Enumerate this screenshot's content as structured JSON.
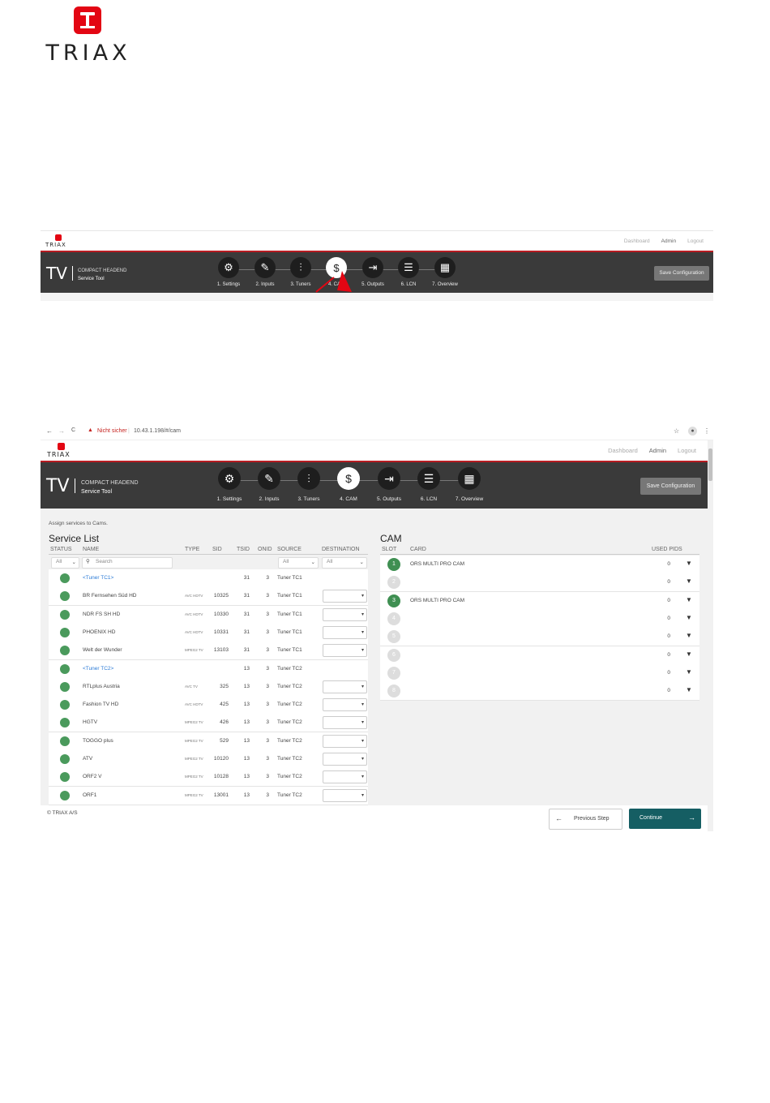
{
  "logo": {
    "word": "TRIAX"
  },
  "screen1": {
    "logo_word": "TRIAX",
    "top_links": [
      "Dashboard",
      "Admin",
      "Logout"
    ],
    "brand": {
      "tv": "TV",
      "line1": "COMPACT HEADEND",
      "line2": "Service Tool"
    },
    "steps": [
      {
        "label": "1. Settings",
        "icon": "gear-icon",
        "glyph": "⚙"
      },
      {
        "label": "2. Inputs",
        "icon": "plug-icon",
        "glyph": "✎"
      },
      {
        "label": "3. Tuners",
        "icon": "sliders-icon",
        "glyph": "⫶"
      },
      {
        "label": "4. CAM",
        "icon": "cam-card-icon",
        "glyph": "$"
      },
      {
        "label": "5. Outputs",
        "icon": "output-icon",
        "glyph": "⇥"
      },
      {
        "label": "6. LCN",
        "icon": "list-icon",
        "glyph": "☰"
      },
      {
        "label": "7. Overview",
        "icon": "grid-icon",
        "glyph": "▦"
      }
    ],
    "save_label": "Save Configuration",
    "annotation_color": "#e30613"
  },
  "screen2": {
    "browser": {
      "warning": "Nicht sicher",
      "url": "10.43.1.198/#/cam",
      "back": "←",
      "forward": "→",
      "reload": "C",
      "star": "☆",
      "menu": "⋮"
    },
    "logo_word": "TRIAX",
    "top_links": [
      "Dashboard",
      "Admin",
      "Logout"
    ],
    "brand": {
      "tv": "TV",
      "line1": "COMPACT HEADEND",
      "line2": "Service Tool"
    },
    "steps": [
      {
        "label": "1. Settings",
        "icon": "gear-icon",
        "glyph": "⚙"
      },
      {
        "label": "2. Inputs",
        "icon": "plug-icon",
        "glyph": "✎"
      },
      {
        "label": "3. Tuners",
        "icon": "sliders-icon",
        "glyph": "⫶"
      },
      {
        "label": "4. CAM",
        "icon": "cam-card-icon",
        "glyph": "$"
      },
      {
        "label": "5. Outputs",
        "icon": "output-icon",
        "glyph": "⇥"
      },
      {
        "label": "6. LCN",
        "icon": "list-icon",
        "glyph": "☰"
      },
      {
        "label": "7. Overview",
        "icon": "grid-icon",
        "glyph": "▦"
      }
    ],
    "save_label": "Save Configuration",
    "intro": "Assign services to Cams.",
    "service_list": {
      "title": "Service List",
      "columns": [
        "STATUS",
        "NAME",
        "TYPE",
        "SID",
        "TSID",
        "ONID",
        "SOURCE",
        "DESTINATION"
      ],
      "filter_status": "All",
      "search_placeholder": "Search",
      "filter_source": "All",
      "filter_destination": "All",
      "rows": [
        {
          "name": "<Tuner TC1>",
          "type": "",
          "sid": "",
          "tsid": "31",
          "onid": "3",
          "source": "Tuner TC1",
          "group": true
        },
        {
          "name": "BR Fernsehen Süd HD",
          "type": "AVC HDTV",
          "sid": "10325",
          "tsid": "31",
          "onid": "3",
          "source": "Tuner TC1",
          "group": false
        },
        {
          "name": "NDR FS SH HD",
          "type": "AVC HDTV",
          "sid": "10330",
          "tsid": "31",
          "onid": "3",
          "source": "Tuner TC1",
          "group": false
        },
        {
          "name": "PHOENIX HD",
          "type": "AVC HDTV",
          "sid": "10331",
          "tsid": "31",
          "onid": "3",
          "source": "Tuner TC1",
          "group": false
        },
        {
          "name": "Welt der Wunder",
          "type": "MPEG2 TV",
          "sid": "13103",
          "tsid": "31",
          "onid": "3",
          "source": "Tuner TC1",
          "group": false
        },
        {
          "name": "<Tuner TC2>",
          "type": "",
          "sid": "",
          "tsid": "13",
          "onid": "3",
          "source": "Tuner TC2",
          "group": true
        },
        {
          "name": "RTLplus Austria",
          "type": "AVC TV",
          "sid": "325",
          "tsid": "13",
          "onid": "3",
          "source": "Tuner TC2",
          "group": false
        },
        {
          "name": "Fashion TV HD",
          "type": "AVC HDTV",
          "sid": "425",
          "tsid": "13",
          "onid": "3",
          "source": "Tuner TC2",
          "group": false
        },
        {
          "name": "HGTV",
          "type": "MPEG2 TV",
          "sid": "426",
          "tsid": "13",
          "onid": "3",
          "source": "Tuner TC2",
          "group": false
        },
        {
          "name": "TOGGO plus",
          "type": "MPEG2 TV",
          "sid": "529",
          "tsid": "13",
          "onid": "3",
          "source": "Tuner TC2",
          "group": false
        },
        {
          "name": "ATV",
          "type": "MPEG2 TV",
          "sid": "10120",
          "tsid": "13",
          "onid": "3",
          "source": "Tuner TC2",
          "group": false
        },
        {
          "name": "ORF2 V",
          "type": "MPEG2 TV",
          "sid": "10128",
          "tsid": "13",
          "onid": "3",
          "source": "Tuner TC2",
          "group": false
        },
        {
          "name": "ORF1",
          "type": "MPEG2 TV",
          "sid": "13001",
          "tsid": "13",
          "onid": "3",
          "source": "Tuner TC2",
          "group": false
        }
      ]
    },
    "cam": {
      "title": "CAM",
      "columns": [
        "SLOT",
        "CARD",
        "USED PIDS"
      ],
      "rows": [
        {
          "slot": "1",
          "card": "ORS MULTI PRO CAM",
          "pids": "0",
          "active": true
        },
        {
          "slot": "2",
          "card": "",
          "pids": "0",
          "active": false
        },
        {
          "slot": "3",
          "card": "ORS MULTI PRO CAM",
          "pids": "0",
          "active": true
        },
        {
          "slot": "4",
          "card": "",
          "pids": "0",
          "active": false
        },
        {
          "slot": "5",
          "card": "",
          "pids": "0",
          "active": false
        },
        {
          "slot": "6",
          "card": "",
          "pids": "0",
          "active": false
        },
        {
          "slot": "7",
          "card": "",
          "pids": "0",
          "active": false
        },
        {
          "slot": "8",
          "card": "",
          "pids": "0",
          "active": false
        }
      ]
    },
    "footer": {
      "copyright": "© TRIAX A/S",
      "prev_label": "Previous Step",
      "continue_label": "Continue"
    },
    "colors": {
      "status_green": "#4a9a5c",
      "continue_bg": "#155e63",
      "accent_red": "#b81c22"
    }
  }
}
